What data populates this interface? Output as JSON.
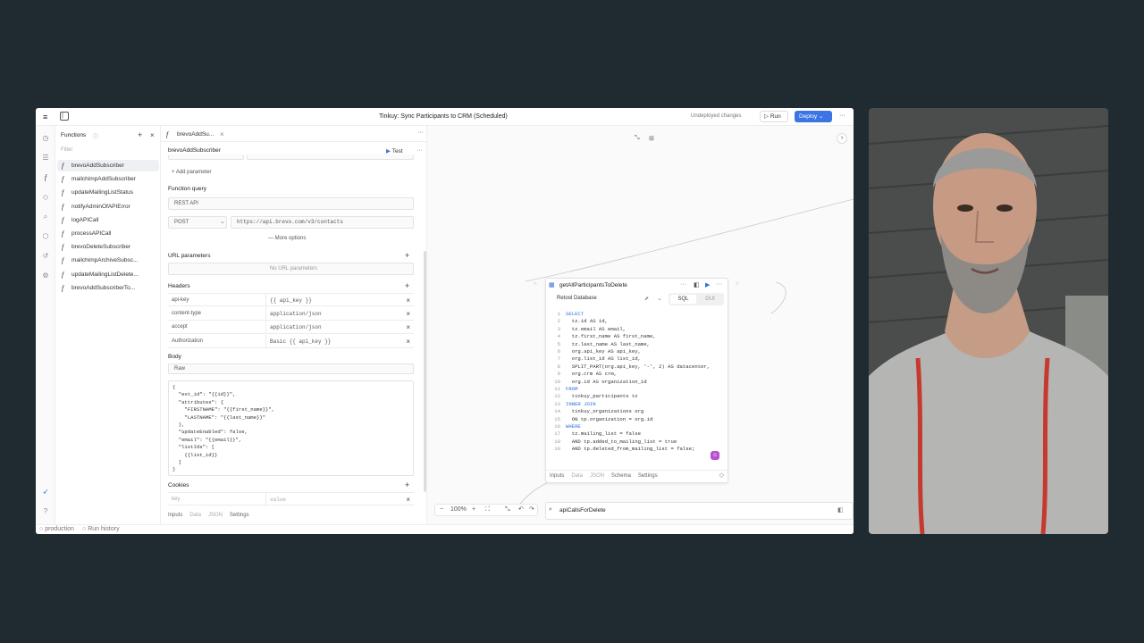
{
  "app": {
    "title": "Tinkuy: Sync Participants to CRM (Scheduled)",
    "undeployed": "Undeployed changes",
    "run_label": "Run",
    "deploy_label": "Deploy",
    "more": "···"
  },
  "functions": {
    "title": "Functions",
    "filter_placeholder": "Filter",
    "items": [
      "brevoAddSubscriber",
      "mailchimpAddSubscriber",
      "updateMailingListStatus",
      "notifyAdminOfAPIError",
      "logAPICall",
      "processAPICall",
      "brevoDeleteSubscriber",
      "mailchimpArchiveSubsc...",
      "updateMailingListDelete...",
      "brevoAddSubscriberTo..."
    ]
  },
  "editor": {
    "tab_label": "brevoAddSu...",
    "fn_name": "brevoAddSubscriber",
    "test_label": "Test",
    "add_param": "Add parameter",
    "fn_query_label": "Function query",
    "resource": "REST API",
    "method": "POST",
    "url": "https://api.brevo.com/v3/contacts",
    "more_options": "More options",
    "url_params_label": "URL parameters",
    "no_url_params": "No URL parameters",
    "headers_label": "Headers",
    "headers": [
      {
        "key": "api-key",
        "value": "{{ api_key }}"
      },
      {
        "key": "content-type",
        "value": "application/json"
      },
      {
        "key": "accept",
        "value": "application/json"
      },
      {
        "key": "Authorization",
        "value": "Basic {{ api_key }}"
      }
    ],
    "body_label": "Body",
    "body_type": "Raw",
    "body_lines": [
      "{",
      "  \"ext_id\": \"{{id}}\",",
      "  \"attributes\": {",
      "    \"FIRSTNAME\": \"{{first_name}}\",",
      "    \"LASTNAME\": \"{{last_name}}\"",
      "  },",
      "  \"updateEnabled\": false,",
      "  \"email\": \"{{email}}\",",
      "  \"listIds\": [",
      "    {{list_id}}",
      "  ]",
      "}"
    ],
    "cookies_label": "Cookies",
    "cookie_key_ph": "key",
    "cookie_val_ph": "value",
    "bottom_tabs": [
      "Inputs",
      "Data",
      "JSON",
      "Settings"
    ]
  },
  "node": {
    "title": "getAllParticipantsToDelete",
    "resource": "Retool Database",
    "mode_sql": "SQL",
    "mode_gui": "GUI",
    "sql": [
      {
        "n": "1",
        "t": "SELECT"
      },
      {
        "n": "2",
        "t": "  tz.id AS id,"
      },
      {
        "n": "3",
        "t": "  tz.email AS email,"
      },
      {
        "n": "4",
        "t": "  tz.first_name AS first_name,"
      },
      {
        "n": "5",
        "t": "  tz.last_name AS last_name,"
      },
      {
        "n": "6",
        "t": "  org.api_key AS api_key,"
      },
      {
        "n": "7",
        "t": "  org.list_id AS list_id,"
      },
      {
        "n": "8",
        "t": "  SPLIT_PART(org.api_key, '-', 2) AS datacenter,"
      },
      {
        "n": "9",
        "t": "  org.crm AS crm,"
      },
      {
        "n": "10",
        "t": "  org.id AS organization_id"
      },
      {
        "n": "11",
        "t": "FROM"
      },
      {
        "n": "12",
        "t": "  tinkuy_participants tz"
      },
      {
        "n": "13",
        "t": "INNER JOIN"
      },
      {
        "n": "14",
        "t": "  tinkuy_organizations org"
      },
      {
        "n": "15",
        "t": "  ON tp.organization = org.id"
      },
      {
        "n": "16",
        "t": "WHERE"
      },
      {
        "n": "17",
        "t": "  tz.mailing_list = false"
      },
      {
        "n": "18",
        "t": "  AND tp.added_to_mailing_list = true"
      },
      {
        "n": "19",
        "t": "  AND tp.deleted_from_mailing_list = false;"
      }
    ],
    "tabs": [
      "Inputs",
      "Data",
      "JSON",
      "Schema",
      "Settings"
    ]
  },
  "node2": {
    "title": "apiCallsForDelete"
  },
  "canvas": {
    "zoom": "100%"
  },
  "status": {
    "env": "production",
    "history": "Run history"
  }
}
